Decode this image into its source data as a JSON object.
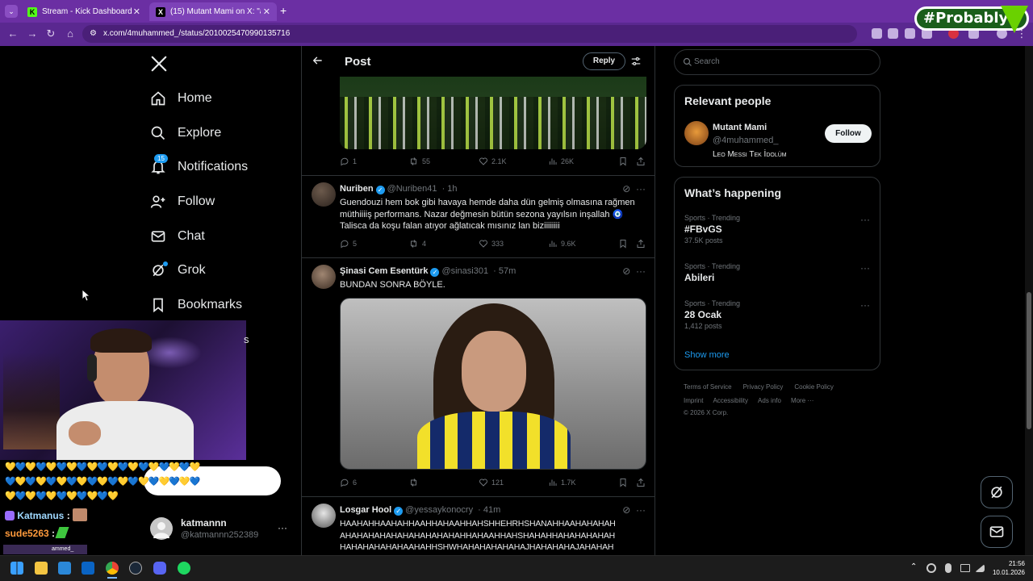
{
  "browser": {
    "tabs": [
      {
        "title": "Stream - Kick Dashboard",
        "favicon": "K"
      },
      {
        "title": "(15) Mutant Mami on X: \"amk ...",
        "favicon": "X"
      }
    ],
    "url": "x.com/4muhammed_/status/2010025470990135716"
  },
  "overlay": {
    "badge": "#Probably"
  },
  "nav": {
    "items": [
      {
        "label": "Home",
        "icon": "home-icon"
      },
      {
        "label": "Explore",
        "icon": "search-icon"
      },
      {
        "label": "Notifications",
        "icon": "bell-icon",
        "badge": "15"
      },
      {
        "label": "Follow",
        "icon": "person-plus-icon"
      },
      {
        "label": "Chat",
        "icon": "mail-icon"
      },
      {
        "label": "Grok",
        "icon": "grok-icon"
      },
      {
        "label": "Bookmarks",
        "icon": "bookmark-icon"
      }
    ],
    "profile": {
      "name": "katmannn",
      "handle": "@katmannn252389"
    }
  },
  "header": {
    "title": "Post",
    "reply_label": "Reply"
  },
  "tweets": [
    {
      "stats": {
        "replies": "1",
        "reposts": "55",
        "likes": "2.1K",
        "views": "26K"
      }
    },
    {
      "name": "Nuriben",
      "handle": "@Nuriben41",
      "time": "· 1h",
      "lines": [
        "Guendouzi hem bok gibi havaya hemde daha dün gelmiş olmasına rağmen",
        "müthiiiiş performans. Nazar değmesin bütün sezona yayılsın inşallah 🧿",
        "Talisca da koşu falan atıyor ağlatıcak mısınız lan biziiiiiiii"
      ],
      "stats": {
        "replies": "5",
        "reposts": "4",
        "likes": "333",
        "views": "9.6K"
      }
    },
    {
      "name": "Şinasi Cem Esentürk",
      "handle": "@sinasi301",
      "time": "· 57m",
      "lines": [
        "BUNDAN SONRA BÖYLE."
      ],
      "stats": {
        "replies": "6",
        "reposts": "",
        "likes": "121",
        "views": "1.7K"
      }
    },
    {
      "name": "Losgar Hool",
      "handle": "@yessaykonocry",
      "time": "· 41m",
      "lines": [
        "HAAHAHHAAHAHHAAHHAHAAHHAHSHHEHRHSHANAHHAAHAHAHAH",
        "AHAHAHAHAHAHAHAHAHAHAHHAHAAHHAHSHAHAHHAHAHAHAHAH",
        "HAHAHAHAHAHAAHAHHSHWHAHAHAHAHAHAJHAHAHAHAJAHAHAH"
      ]
    }
  ],
  "right": {
    "search_placeholder": "Search",
    "relevant": {
      "title": "Relevant people",
      "name": "Mutant Mami",
      "handle": "@4muhammed_",
      "bio": "Leo Messi Tek İdolüm",
      "follow_label": "Follow"
    },
    "happening": {
      "title": "What’s happening",
      "trends": [
        {
          "meta": "Sports · Trending",
          "name": "#FBvGS",
          "count": "37.5K posts"
        },
        {
          "meta": "Sports · Trending",
          "name": "Abileri",
          "count": ""
        },
        {
          "meta": "Sports · Trending",
          "name": "28 Ocak",
          "count": "1,412 posts"
        }
      ],
      "show_more": "Show more"
    },
    "footer": {
      "links": [
        "Terms of Service",
        "Privacy Policy",
        "Cookie Policy",
        "Imprint",
        "Accessibility",
        "Ads info",
        "More ···"
      ],
      "copyright": "© 2026 X Corp."
    }
  },
  "chat": {
    "messages": [
      {
        "user": "Katmanus",
        "sep": ":",
        "color": "#9fd8ff"
      },
      {
        "user": "sude5263",
        "sep": ":",
        "color": "#ff9a3c"
      }
    ],
    "partial_text": "ammed_"
  },
  "clock": {
    "time": "21:56",
    "date": "10.01.2026"
  }
}
